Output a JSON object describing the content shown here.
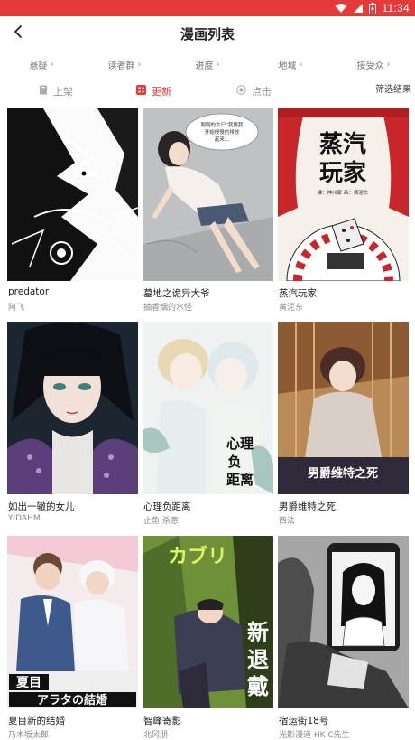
{
  "status_bar": {
    "time": "11:34",
    "background": "#e43a3a"
  },
  "header": {
    "title": "漫画列表"
  },
  "filters": [
    {
      "label": "悬疑"
    },
    {
      "label": "读者群"
    },
    {
      "label": "进度"
    },
    {
      "label": "地域"
    },
    {
      "label": "接受众"
    }
  ],
  "sort_tabs": {
    "shelf": "上架",
    "update": "更新",
    "click": "点击",
    "active": "update",
    "accent": "#e43a3a"
  },
  "filter_result_label": "筛选结果",
  "comics": [
    {
      "title": "predator",
      "author": "阿飞",
      "cover": "ink-monster"
    },
    {
      "title": "墓地之诡异大爷",
      "author": "抽香烟的水怪",
      "cover": "girl-lying",
      "cover_text": [
        "刚刚的女尸”我要我",
        "开始慢慢的排放",
        "起来..."
      ]
    },
    {
      "title": "蒸汽玩家",
      "author": "黄泥东",
      "cover": "steam-player",
      "cover_text": [
        "蒸汽",
        "玩家",
        "编：神州家  画：黄泥东"
      ]
    },
    {
      "title": "如出一辙的女儿",
      "author": "YIDAHM",
      "cover": "dark-girl"
    },
    {
      "title": "心理负距离",
      "author": "止鱼 杀意",
      "cover": "two-boys",
      "cover_text": [
        "心理",
        "负",
        "距离"
      ]
    },
    {
      "title": "男爵维特之死",
      "author": "西法",
      "cover": "baron",
      "cover_text": "男爵维特之死"
    },
    {
      "title": "夏目新的结婚",
      "author": "乃木坂太郎",
      "cover": "wedding",
      "cover_text": [
        "夏目",
        "アラタの結婚"
      ]
    },
    {
      "title": "智峰寄影",
      "author": "北冈朋",
      "cover": "green-forest",
      "cover_text": [
        "カブリ",
        "新",
        "退",
        "戴"
      ]
    },
    {
      "title": "宿运街18号",
      "author": "光影漫道 HK C先生",
      "cover": "phone-woman"
    }
  ]
}
